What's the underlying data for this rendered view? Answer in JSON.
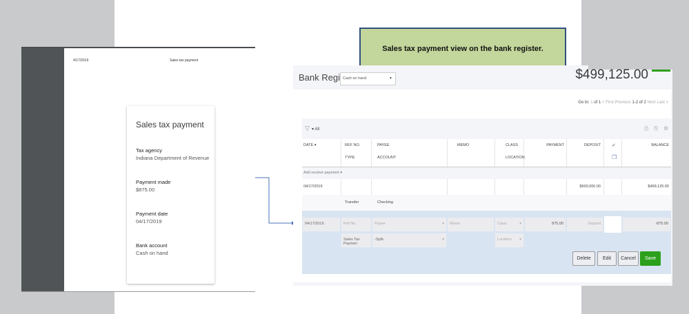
{
  "callout": "Sales tax payment view on the bank register.",
  "left": {
    "date": "4/17/2019",
    "header": "Sales tax payment",
    "card": {
      "title": "Sales tax payment",
      "fields": [
        {
          "label": "Tax agency",
          "value": "Indiana Department of Revenue"
        },
        {
          "label": "Payment made",
          "value": "$875.00"
        },
        {
          "label": "Payment date",
          "value": "04/17/2019"
        },
        {
          "label": "Bank account",
          "value": "Cash on hand"
        }
      ]
    }
  },
  "register": {
    "title": "Bank Register",
    "account": "Cash on hand",
    "balance": "$499,125.00",
    "pager": {
      "goto": "Go to:",
      "page": "1",
      "of": "of 1",
      "first": "< First",
      "previous": "Previous",
      "range": "1-2 of 2",
      "next": "Next",
      "last": "Last >"
    },
    "filter": "All",
    "columns": {
      "date": "DATE",
      "ref": "REF NO.",
      "type": "TYPE",
      "payee": "PAYEE",
      "account": "ACCOUNT",
      "memo": "MEMO",
      "class": "CLASS",
      "location": "LOCATION",
      "payment": "PAYMENT",
      "deposit": "DEPOSIT",
      "check": "✓",
      "balance": "BALANCE"
    },
    "add_label": "Add receive payment",
    "row1": {
      "date": "04/17/2019",
      "deposit": "$500,000.00",
      "balance": "$499,125.00",
      "type": "Transfer",
      "account": "Checking"
    },
    "edit": {
      "date": "04/17/2019",
      "ref": "Ref No.",
      "payee": "Payee",
      "memo": "Memo",
      "class": "Class",
      "payment": "875.00",
      "deposit": "Deposit",
      "balance": "-875.00",
      "type": "Sales Tax Paymen",
      "account": "-Split-",
      "location": "Location"
    },
    "buttons": {
      "delete": "Delete",
      "edit": "Edit",
      "cancel": "Cancel",
      "save": "Save"
    }
  }
}
